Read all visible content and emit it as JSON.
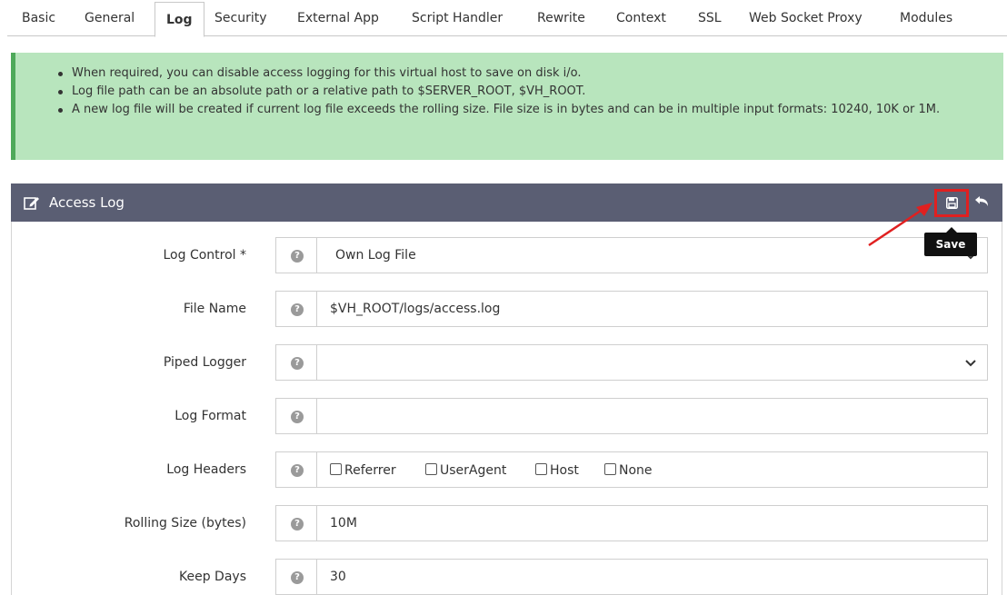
{
  "tabs": [
    "Basic",
    "General",
    "Log",
    "Security",
    "External App",
    "Script Handler",
    "Rewrite",
    "Context",
    "SSL",
    "Web Socket Proxy",
    "Modules"
  ],
  "active_tab": "Log",
  "info": {
    "items": [
      "When required, you can disable access logging for this virtual host to save on disk i/o.",
      "Log file path can be an absolute path or a relative path to $SERVER_ROOT, $VH_ROOT.",
      "A new log file will be created if current log file exceeds the rolling size. File size is in bytes and can be in multiple input formats: 10240, 10K or 1M."
    ]
  },
  "panel": {
    "title": "Access Log",
    "save_tooltip": "Save"
  },
  "fields": {
    "log_control": {
      "label": "Log Control *",
      "value": "Own Log File"
    },
    "file_name": {
      "label": "File Name",
      "value": "$VH_ROOT/logs/access.log"
    },
    "piped_logger": {
      "label": "Piped Logger",
      "value": ""
    },
    "log_format": {
      "label": "Log Format",
      "value": ""
    },
    "log_headers": {
      "label": "Log Headers",
      "options": [
        "Referrer",
        "UserAgent",
        "Host",
        "None"
      ]
    },
    "rolling_size": {
      "label": "Rolling Size (bytes)",
      "value": "10M"
    },
    "keep_days": {
      "label": "Keep Days",
      "value": "30"
    }
  },
  "help_glyph": "?",
  "colors": {
    "info_bg": "#b8e5bd",
    "info_border": "#4ea95a",
    "panel_header": "#5a5e73",
    "highlight": "#e02020"
  },
  "icons": [
    "edit-icon",
    "save-icon",
    "undo-icon",
    "help-icon",
    "chevron-down-icon",
    "annotation-arrow"
  ]
}
